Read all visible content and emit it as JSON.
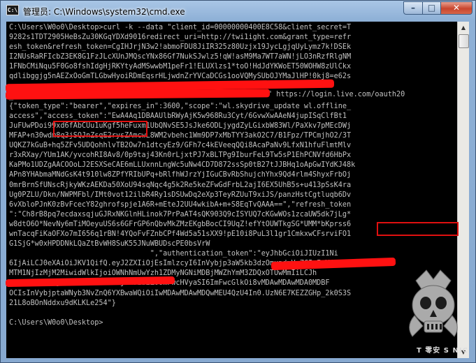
{
  "window": {
    "title": "管理员: C:\\Windows\\system32\\cmd.exe",
    "icon_label": "C:\\",
    "buttons": {
      "minimize": "–",
      "maximize": "□",
      "close": "✕"
    }
  },
  "console": {
    "text": "C:\\Users\\W0o0\\Desktop>curl -k --data \"client_id=00000000400E8C58&client_secret=T\n9282s1TDT2905HeBsZu30KGqYDXd9016redirect_uri=http://twi1ight.com&grant_type=refr\nesh_token&refresh_token=CgIHJrjN3w2!abmoFDU8JiIR325z80Uzjx19JycLgjqUyLymz7k!DSEk\nI2NUsRaRFIcbZ3EK8G1FzJLcXUnJMQscYNx86Gf7NukSJwlz5!qW!asM9Ma7WT7aWN!jLO3nRzfRlgNM\n1FNbCMiNqu5F0Go8fshIdgHjRKYtyAdMSwwbM1peFr1!ELUXlzs1*toO!HdJdYKWoET50WOHW8zUlCkx\nqdlibggjg5nAEZxOoGmTLGbwHyoiRDmEqsrHLjwdnZrYVCaDCGs1ooVQMySUbOJYMaJlHP!0kj8=e62s\n\n_token.srf\n{\"token_type\":\"bearer\",\"expires_in\":3600,\"scope\":\"wl.skydrive_update wl.offline_\naccess\",\"access_token\":\"EwA4Aq1DBAAUlbRWyAjK5w968Ru3Cyt/6GvwXwAAeN4jupISqClfBt1\nJuFUwPDoi99xd6fAbCUu1uKgf5heFuxm1UbQNvSE5JsJke6ODLjygdZyLGixbW83Wl/PaXkv7pMEcDWj\nMFAP+n30wdm8q3jSQJnZsqE2rysZAmcwL8WM2vbehc1Wm9DP7xMbTYY3akO2C7/B1Fpz/TPCmjhO2/3T\nUQKZ7kGuB+hq5ZFv5UDQohhlvTB2Ow7n1dtcyEz9/GFh7c4kEVeeqQQi8AcaPaNv9LfxN1hfuFlmtMlv\nr3xRXay/YUm1AK/yvcohRI8Av8/0p9taj43Kn0rLjxtPJ7xBLTPg9IburFeL9Tw5sP1EhPCNVfd6HbPx\nKaPMo1UDZgAACOOoLJ2ESXSeCAE6mLLUxnnLngWc5uNw4CD7D872ssSp0tB27tJJBHq1oApGwIYdKJ48k\nAPn8YHAbmaMNdGsK4t910lw8ZPfYRIbUPq+bRlfhWJrzYjIGuCBvRbShujchYhx9Qd4rlm4ShyxFrbOj\n0mrBrnSfUNscRjkyWKzAEKDa50XoU94sqNqc4g5k2Re5keZFwGdFrbL2ajI6EX5UhB5s+u413pSsK4ra\nUg0PZLU/Dkn/NWPMFbl/IMt0vot12ilbR4Ry1sDSUwDq2eXp3TeyRZUuT9xiJS/panzHstCgtluqb6Dv\n6vXbloPJnK0zBvFcecY82ghrofspje1A6R+mEteJ2UU4wkibA+m+S8EqTvQAAA==\",\"refresh_token\n\":\"Ch8rB8pq7ecdaxsqjuGJRxNKGlnHLinok7PrPaAT4sQK903Q9cISYUQ7cKGwWOs1zcaUW5dk7jLg*\nw8dtO6O*NevNy6mTiMOeyuUS6s6GFrGP6nQbvMkZMzEKgbBocCI9UqZ!efYtOUWTkgSG*UMM*bKprss6\nwnTacqFiKaOFXo7mI656q1rBN!4YQoFvFZnbCPf4Wd5a51sXX9!pE10i8PuL3l1gr1CmkxwCFsrviFO1\nG1SjG*w0xHPDDNkLQaZtBvWH8SuK55JNuWBUDscPE0bsVrW\n                                 \",\"authentication_token\":\"eyJhbGciOiJIUzI1Ni\n6IjAiLCJ0eXAiOiJKV1QifQ.eyJ2ZXIiOjEsImlzcyI6InVybjp3aW5kb3dzOmxpdmVpZCIsImV4\nMTM1NjIzMjM2MiwidWlkIjoiOWNhNmUwYzh1ZDMyNGNiMDBjMWZhYmM3ZDQxOTUwMmIiLCJh\nd2kxaWdodC5jb20iLCJicm46Wljcm9zb2Z0OmFwcHVyaSI6ImFwcGlkOi8vMDAwMDAwMDA0MDBF\nOCIsInVybjptaWNyb3NvZnQ6YXBwaWQiOiIwMDAwMDAwMDQwMEU4QzU4In0.UzN6E7KEZZGHp_2k0S3S\n21L8oBOnNddxu9dKLKLe254\"}\n\nC:\\Users\\W0o0\\Desktop>",
    "url_fragment": "\" https://login.live.com/oauth20",
    "boxed_labels": [
      "\"access_token",
      "refresh_token"
    ]
  },
  "watermark": {
    "text": "T 零安 S NIC"
  }
}
